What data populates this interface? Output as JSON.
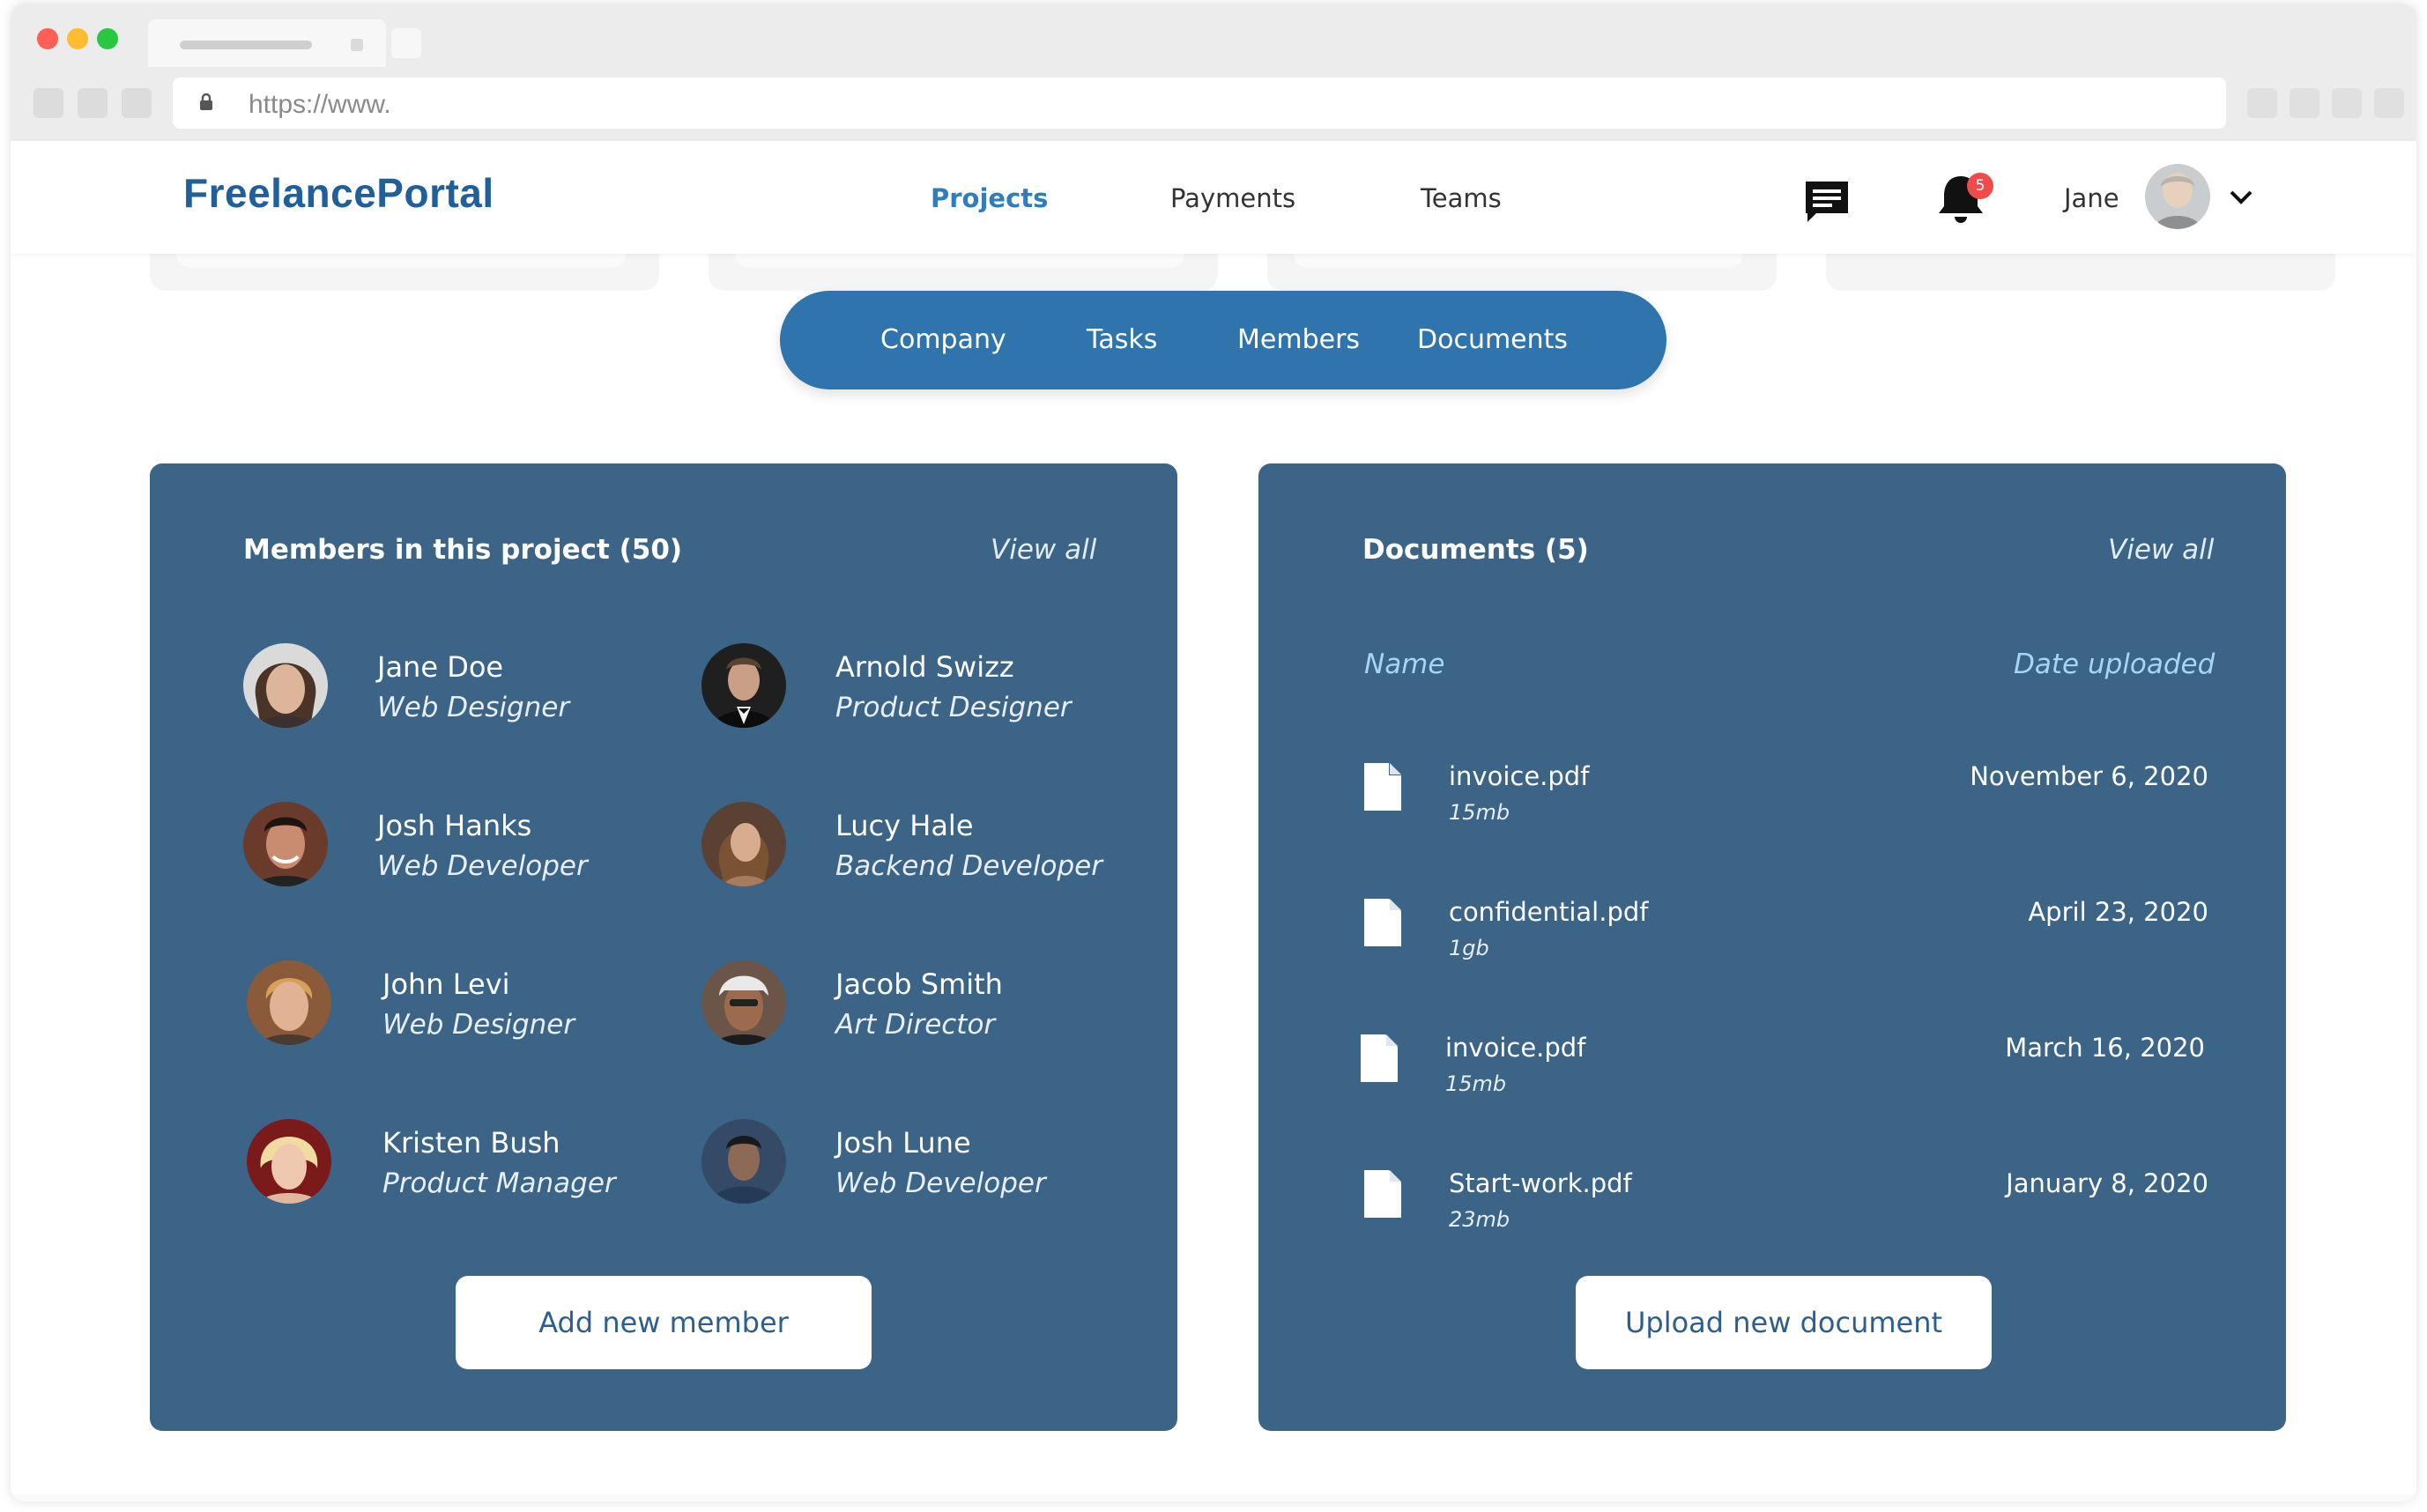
{
  "browser": {
    "url": "https://www."
  },
  "header": {
    "logo": "FreelancePortal",
    "nav": [
      {
        "label": "Projects",
        "active": true
      },
      {
        "label": "Payments",
        "active": false
      },
      {
        "label": "Teams",
        "active": false
      }
    ],
    "icons": {
      "messages": "chat-icon",
      "notifications": "bell-icon"
    },
    "notification_count": "5",
    "user_name": "Jane"
  },
  "subnav": {
    "items": [
      "Company",
      "Tasks",
      "Members",
      "Documents"
    ]
  },
  "members_panel": {
    "title": "Members in this project (50)",
    "view_all": "View all",
    "members": [
      {
        "name": "Jane Doe",
        "role": "Web Designer"
      },
      {
        "name": "Arnold Swizz",
        "role": "Product Designer"
      },
      {
        "name": "Josh Hanks",
        "role": "Web Developer"
      },
      {
        "name": "Lucy Hale",
        "role": "Backend Developer"
      },
      {
        "name": "John Levi",
        "role": "Web Designer"
      },
      {
        "name": "Jacob Smith",
        "role": "Art Director"
      },
      {
        "name": "Kristen Bush",
        "role": "Product Manager"
      },
      {
        "name": "Josh Lune",
        "role": "Web Developer"
      }
    ],
    "add_button": "Add new member"
  },
  "documents_panel": {
    "title": "Documents (5)",
    "view_all": "View all",
    "col_name": "Name",
    "col_date": "Date uploaded",
    "documents": [
      {
        "name": "invoice.pdf",
        "size": "15mb",
        "date": "November 6, 2020"
      },
      {
        "name": "confidential.pdf",
        "size": "1gb",
        "date": "April 23, 2020"
      },
      {
        "name": "invoice.pdf",
        "size": "15mb",
        "date": "March 16, 2020"
      },
      {
        "name": "Start-work.pdf",
        "size": "23mb",
        "date": "January 8, 2020"
      }
    ],
    "upload_button": "Upload new document"
  },
  "colors": {
    "brand": "#1f5f9a",
    "active_nav": "#2f7cbf",
    "pill": "#2f74ad",
    "panel": "#3b6486",
    "column_header": "#a9d4f4",
    "badge": "#ef4b4b"
  }
}
